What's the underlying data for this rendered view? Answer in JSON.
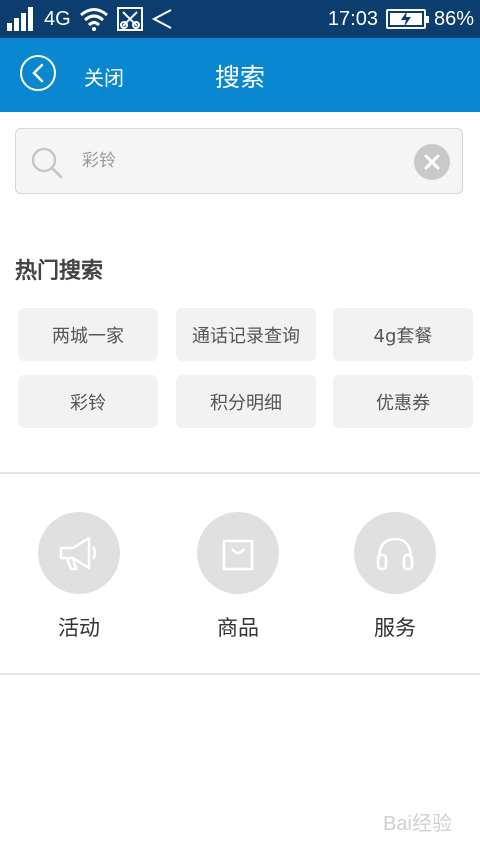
{
  "status_bar": {
    "network": "4G",
    "time": "17:03",
    "battery": "86%"
  },
  "header": {
    "close_label": "关闭",
    "title": "搜索"
  },
  "search": {
    "placeholder": "彩铃"
  },
  "hot_search": {
    "title": "热门搜索",
    "tags": [
      "两城一家",
      "通话记录查询",
      "4g套餐",
      "彩铃",
      "积分明细",
      "优惠券"
    ]
  },
  "categories": [
    {
      "label": "活动",
      "icon": "megaphone-icon"
    },
    {
      "label": "商品",
      "icon": "shopping-bag-icon"
    },
    {
      "label": "服务",
      "icon": "headphones-icon"
    }
  ],
  "watermark": "Bai经验",
  "colors": {
    "status_bar_bg": "#0b3d6e",
    "header_bg": "#0a87d1"
  }
}
